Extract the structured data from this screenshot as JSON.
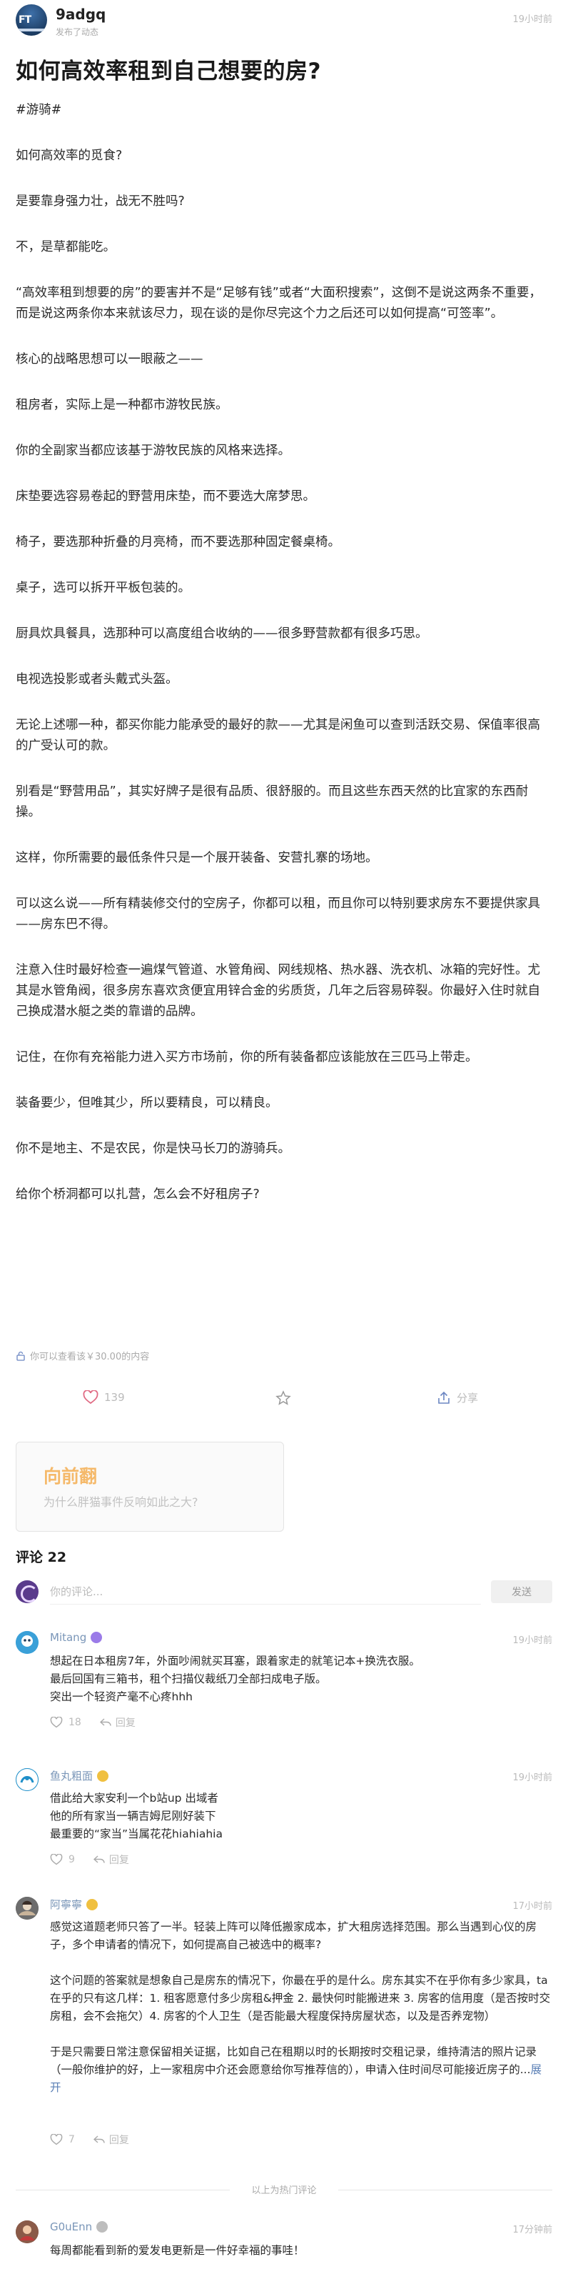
{
  "author": {
    "name": "9adgq",
    "subtitle": "发布了动态",
    "avatar_text": "FT",
    "time": "19小时前"
  },
  "post": {
    "title": "如何高效率租到自己想要的房?",
    "paragraphs": [
      "#游骑#",
      "如何高效率的觅食?",
      "是要靠身强力壮，战无不胜吗?",
      "不，是草都能吃。",
      "“高效率租到想要的房”的要害并不是“足够有钱”或者“大面积搜索”，这倒不是说这两条不重要，而是说这两条你本来就该尽力，现在谈的是你尽完这个力之后还可以如何提高“可签率”。",
      "核心的战略思想可以一眼蔽之——",
      "租房者，实际上是一种都市游牧民族。",
      "你的全副家当都应该基于游牧民族的风格来选择。",
      "床垫要选容易卷起的野营用床垫，而不要选大席梦思。",
      "椅子，要选那种折叠的月亮椅，而不要选那种固定餐桌椅。",
      "桌子，选可以拆开平板包装的。",
      "厨具炊具餐具，选那种可以高度组合收纳的——很多野营款都有很多巧思。",
      "电视选投影或者头戴式头盔。",
      "无论上述哪一种，都买你能力能承受的最好的款——尤其是闲鱼可以查到活跃交易、保值率很高的广受认可的款。",
      "别看是“野营用品”，其实好牌子是很有品质、很舒服的。而且这些东西天然的比宜家的东西耐操。",
      "这样，你所需要的最低条件只是一个展开装备、安营扎寨的场地。",
      "可以这么说——所有精装修交付的空房子，你都可以租，而且你可以特别要求房东不要提供家具——房东巴不得。",
      "注意入住时最好检查一遍煤气管道、水管角阀、网线规格、热水器、洗衣机、冰箱的完好性。尤其是水管角阀，很多房东喜欢贪便宜用锌合金的劣质货，几年之后容易碎裂。你最好入住时就自己换成潜水艇之类的靠谱的品牌。",
      "记住，在你有充裕能力进入买方市场前，你的所有装备都应该能放在三匹马上带走。",
      "装备要少，但唯其少，所以要精良，可以精良。",
      "你不是地主、不是农民，你是快马长刀的游骑兵。",
      "给你个桥洞都可以扎营，怎么会不好租房子?"
    ],
    "paywall_note": "你可以查看该￥30.00的内容",
    "like_count": "139",
    "share_label": "分享"
  },
  "related_card": {
    "title": "向前翻",
    "subtitle": "为什么胖猫事件反响如此之大?"
  },
  "comments_section": {
    "heading": "评论 22",
    "input_placeholder": "你的评论...",
    "send_label": "发送",
    "hot_divider": "以上为热门评论",
    "reply_label": "回复"
  },
  "comments": [
    {
      "name": "Mitang",
      "time": "19小时前",
      "lines": [
        "想起在日本租房7年，外面吵闹就买耳塞，跟着家走的就笔记本+换洗衣服。",
        "最后回国有三箱书，租个扫描仪裁纸刀全部扫成电子版。",
        "突出一个轻资产毫不心疼hhh"
      ],
      "likes": "18"
    },
    {
      "name": "鱼丸粗面",
      "time": "19小时前",
      "lines": [
        "借此给大家安利一个b站up 出域者",
        "他的所有家当一辆吉姆尼刚好装下",
        "最重要的“家当”当属花花hiahiahia"
      ],
      "likes": "9"
    },
    {
      "name": "阿寧寧",
      "time": "17小时前",
      "lines": [
        "感觉这道题老师只答了一半。轻装上阵可以降低搬家成本，扩大租房选择范围。那么当遇到心仪的房子，多个申请者的情况下，如何提高自己被选中的概率?",
        "",
        "这个问题的答案就是想象自己是房东的情况下，你最在乎的是什么。房东其实不在乎你有多少家具，ta在乎的只有这几样：1. 租客愿意付多少房租&押金 2. 最快何时能搬进来 3. 房客的信用度（是否按时交房租，会不会拖欠）4. 房客的个人卫生（是否能最大程度保持房屋状态，以及是否养宠物）",
        "",
        "于是只需要日常注意保留相关证据，比如自己在租期以时的长期按时交租记录，维持清洁的照片记录（一般你维护的好，上一家租房中介还会愿意给你写推荐信的），申请入住时间尽可能接近房子的..."
      ],
      "expand_label": "展开",
      "likes": "7"
    },
    {
      "name": "G0uEnn",
      "time": "17分钟前",
      "lines": [
        "每周都能看到新的爱发电更新是一件好幸福的事哇！"
      ]
    }
  ],
  "colors": {
    "accent_link": "#7a96b8",
    "card_title": "#f5b96a",
    "like_heart": "#e06a83",
    "share_icon": "#6b86c2"
  }
}
